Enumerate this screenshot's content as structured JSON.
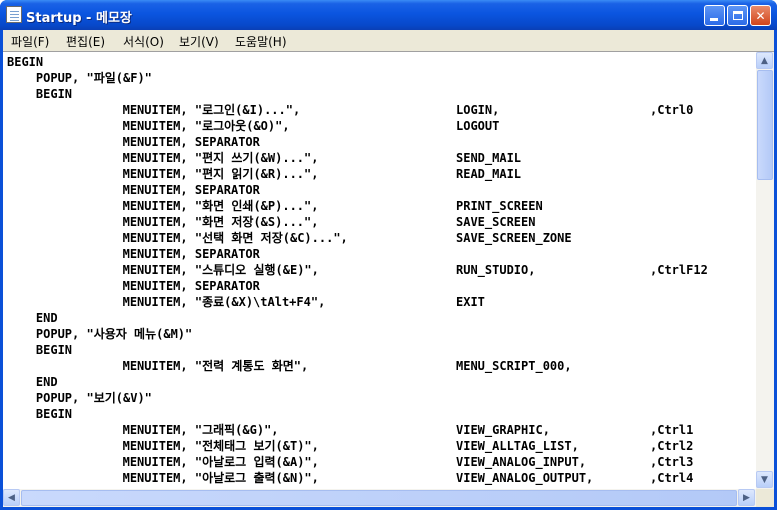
{
  "window": {
    "title": "Startup - 메모장"
  },
  "menu": [
    "파일(F)",
    "편집(E)",
    "서식(O)",
    "보기(V)",
    "도움말(H)"
  ],
  "editor": {
    "lines": [
      {
        "text": "BEGIN",
        "c2": "",
        "c3": ""
      },
      {
        "text": "    POPUP, \"파일(&F)\"",
        "c2": "",
        "c3": ""
      },
      {
        "text": "    BEGIN",
        "c2": "",
        "c3": ""
      },
      {
        "text": "                MENUITEM, \"로그인(&I)...\",",
        "c2": "LOGIN,",
        "c3": ",Ctrl0"
      },
      {
        "text": "                MENUITEM, \"로그아웃(&O)\",",
        "c2": "LOGOUT",
        "c3": ""
      },
      {
        "text": "                MENUITEM, SEPARATOR",
        "c2": "",
        "c3": ""
      },
      {
        "text": "                MENUITEM, \"편지 쓰기(&W)...\",",
        "c2": "SEND_MAIL",
        "c3": ""
      },
      {
        "text": "                MENUITEM, \"편지 읽기(&R)...\",",
        "c2": "READ_MAIL",
        "c3": ""
      },
      {
        "text": "                MENUITEM, SEPARATOR",
        "c2": "",
        "c3": ""
      },
      {
        "text": "                MENUITEM, \"화면 인쇄(&P)...\",",
        "c2": "PRINT_SCREEN",
        "c3": ""
      },
      {
        "text": "                MENUITEM, \"화면 저장(&S)...\",",
        "c2": "SAVE_SCREEN",
        "c3": ""
      },
      {
        "text": "                MENUITEM, \"선택 화면 저장(&C)...\",",
        "c2": "SAVE_SCREEN_ZONE",
        "c3": ""
      },
      {
        "text": "                MENUITEM, SEPARATOR",
        "c2": "",
        "c3": ""
      },
      {
        "text": "                MENUITEM, \"스튜디오 실행(&E)\",",
        "c2": "RUN_STUDIO,",
        "c3": ",CtrlF12"
      },
      {
        "text": "                MENUITEM, SEPARATOR",
        "c2": "",
        "c3": ""
      },
      {
        "text": "                MENUITEM, \"종료(&X)\\tAlt+F4\",",
        "c2": "EXIT",
        "c3": ""
      },
      {
        "text": "    END",
        "c2": "",
        "c3": ""
      },
      {
        "text": "    POPUP, \"사용자 메뉴(&M)\"",
        "c2": "",
        "c3": ""
      },
      {
        "text": "    BEGIN",
        "c2": "",
        "c3": ""
      },
      {
        "text": "                MENUITEM, \"전력 계통도 화면\",",
        "c2": "MENU_SCRIPT_000,",
        "c3": ""
      },
      {
        "text": "    END",
        "c2": "",
        "c3": ""
      },
      {
        "text": "    POPUP, \"보기(&V)\"",
        "c2": "",
        "c3": ""
      },
      {
        "text": "    BEGIN",
        "c2": "",
        "c3": ""
      },
      {
        "text": "                MENUITEM, \"그래픽(&G)\",",
        "c2": "VIEW_GRAPHIC,",
        "c3": ",Ctrl1"
      },
      {
        "text": "                MENUITEM, \"전체태그 보기(&T)\",",
        "c2": "VIEW_ALLTAG_LIST,",
        "c3": ",Ctrl2"
      },
      {
        "text": "                MENUITEM, \"아날로그 입력(&A)\",",
        "c2": "VIEW_ANALOG_INPUT,",
        "c3": ",Ctrl3"
      },
      {
        "text": "                MENUITEM, \"아날로그 출력(&N)\",",
        "c2": "VIEW_ANALOG_OUTPUT,",
        "c3": ",Ctrl4"
      }
    ]
  },
  "scrollbars": {
    "up_arrow": "▲",
    "down_arrow": "▼",
    "left_arrow": "◀",
    "right_arrow": "▶"
  }
}
